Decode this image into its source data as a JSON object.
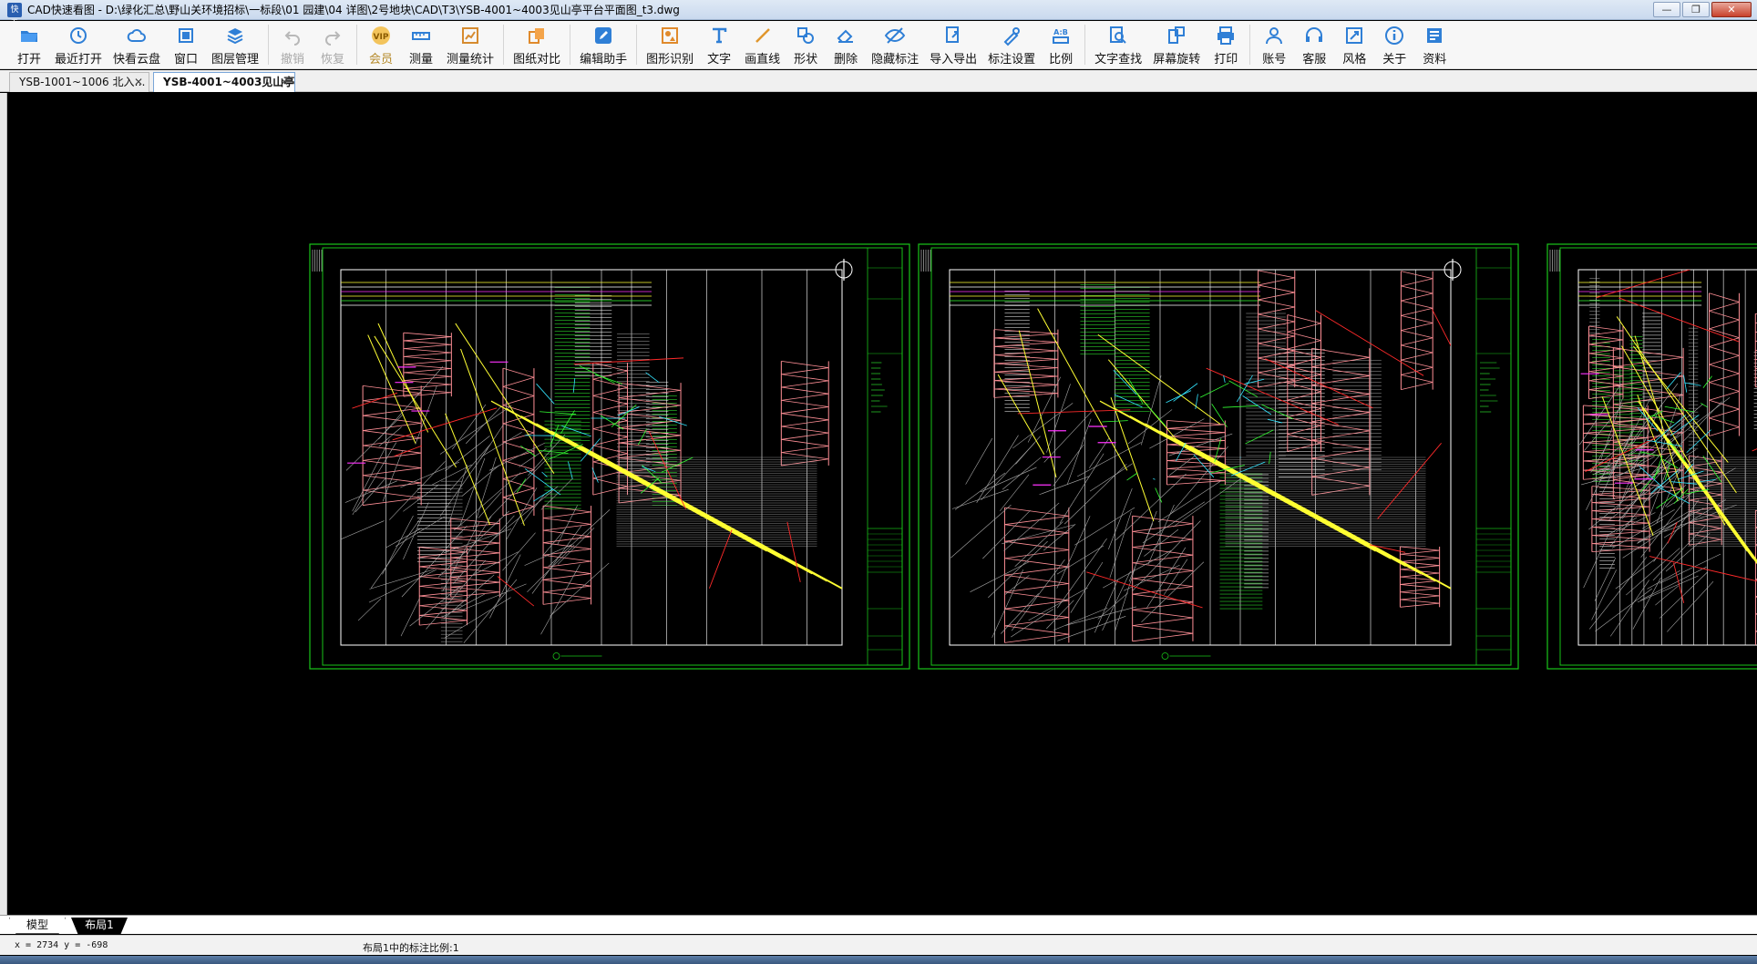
{
  "window": {
    "app_icon_text": "快看",
    "title": "CAD快速看图 - D:\\绿化汇总\\野山关环境招标\\一标段\\01 园建\\04 详图\\2号地块\\CAD\\T3\\YSB-4001~4003见山亭平台平面图_t3.dwg",
    "minimize": "—",
    "maximize": "❐",
    "close": "✕"
  },
  "toolbar": {
    "items": [
      {
        "id": "open",
        "label": "打开",
        "icon": "folder-icon"
      },
      {
        "id": "recent",
        "label": "最近打开",
        "icon": "clock-icon"
      },
      {
        "id": "cloud",
        "label": "快看云盘",
        "icon": "cloud-icon"
      },
      {
        "id": "window",
        "label": "窗口",
        "icon": "window-icon"
      },
      {
        "id": "layers",
        "label": "图层管理",
        "icon": "layers-icon"
      },
      {
        "id": "undo",
        "label": "撤销",
        "icon": "undo-icon",
        "disabled": true
      },
      {
        "id": "redo",
        "label": "恢复",
        "icon": "redo-icon",
        "disabled": true
      },
      {
        "id": "vip",
        "label": "会员",
        "icon": "vip-icon"
      },
      {
        "id": "measure",
        "label": "测量",
        "icon": "ruler-icon"
      },
      {
        "id": "measure_stats",
        "label": "测量统计",
        "icon": "stats-icon"
      },
      {
        "id": "compare",
        "label": "图纸对比",
        "icon": "compare-icon"
      },
      {
        "id": "edit_assist",
        "label": "编辑助手",
        "icon": "edit-assist-icon"
      },
      {
        "id": "shape_recog",
        "label": "图形识别",
        "icon": "shape-recog-icon"
      },
      {
        "id": "text",
        "label": "文字",
        "icon": "text-icon"
      },
      {
        "id": "line",
        "label": "画直线",
        "icon": "line-icon"
      },
      {
        "id": "shape",
        "label": "形状",
        "icon": "shape-icon"
      },
      {
        "id": "erase",
        "label": "删除",
        "icon": "eraser-icon"
      },
      {
        "id": "hide_marks",
        "label": "隐藏标注",
        "icon": "eye-off-icon"
      },
      {
        "id": "import_export",
        "label": "导入导出",
        "icon": "import-export-icon"
      },
      {
        "id": "mark_settings",
        "label": "标注设置",
        "icon": "mark-settings-icon"
      },
      {
        "id": "scale",
        "label": "比例",
        "icon": "scale-icon"
      },
      {
        "id": "text_search",
        "label": "文字查找",
        "icon": "text-search-icon"
      },
      {
        "id": "rotate",
        "label": "屏幕旋转",
        "icon": "rotate-icon"
      },
      {
        "id": "print",
        "label": "打印",
        "icon": "printer-icon"
      },
      {
        "id": "account",
        "label": "账号",
        "icon": "user-icon"
      },
      {
        "id": "support",
        "label": "客服",
        "icon": "headset-icon"
      },
      {
        "id": "style",
        "label": "风格",
        "icon": "style-icon"
      },
      {
        "id": "about",
        "label": "关于",
        "icon": "info-icon"
      },
      {
        "id": "resources",
        "label": "资料",
        "icon": "resources-icon"
      }
    ]
  },
  "tabs": [
    {
      "label": "YSB-1001~1006 北入…",
      "close": "✕",
      "active": false
    },
    {
      "label": "YSB-4001~4003见山亭·",
      "close": "✕",
      "active": true
    }
  ],
  "layout_tabs": {
    "model": "模型",
    "layout1": "布局1"
  },
  "status": {
    "coords": "x = 2734  y = -698",
    "scale_text": "布局1中的标注比例:1"
  },
  "colors": {
    "canvas_bg": "#000000",
    "frame_green": "#19c419",
    "white_line": "#ffffff",
    "pink": "#ff8f96",
    "yellow": "#ffff33",
    "red": "#ff2a2a",
    "green": "#33ff33",
    "cyan": "#33e5ff",
    "magenta": "#ff33ff",
    "gray": "#a8a8a8"
  }
}
